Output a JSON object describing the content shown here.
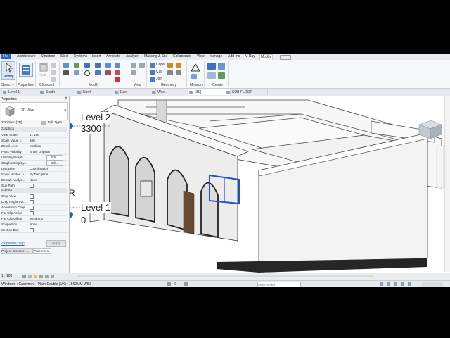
{
  "menu": {
    "tabs": [
      "File",
      "Architecture",
      "Structure",
      "Steel",
      "Systems",
      "Insert",
      "Annotate",
      "Analyze",
      "Massing & Site",
      "Collaborate",
      "View",
      "Manage",
      "Add-Ins",
      "V-Ray",
      "Modify"
    ]
  },
  "ribbon": {
    "select_label": "Select ▾",
    "groups": [
      "Properties",
      "Clipboard",
      "Modify",
      "View",
      "Geometry",
      "Measure",
      "Create"
    ],
    "modify_btn": "Modify",
    "paste_btn": "Paste",
    "cope_label": "Cope",
    "cut_label": "Cut",
    "join_label": "Join"
  },
  "view_tabs": [
    "Level 1",
    "South",
    "North",
    "East",
    "West",
    "{3D}",
    "SUB-FLOOR"
  ],
  "properties": {
    "title": "Properties",
    "type_name": "3D View",
    "selector": "3D View: {3D}",
    "edit_type": "Edit Type",
    "sections": {
      "graphics": "Graphics",
      "extents": "Extents"
    },
    "graphics_rows": [
      {
        "k": "View Scale",
        "v": "1 : 100"
      },
      {
        "k": "Scale Value  1:",
        "v": "100"
      },
      {
        "k": "Detail Level",
        "v": "Medium"
      },
      {
        "k": "Parts Visibility",
        "v": "Show Original"
      },
      {
        "k": "Visibility/Graph...",
        "v": "Edit..."
      },
      {
        "k": "Graphic Display...",
        "v": "Edit..."
      },
      {
        "k": "Discipline",
        "v": "Coordination"
      },
      {
        "k": "Show Hidden Li...",
        "v": "By Discipline"
      },
      {
        "k": "Default Analys...",
        "v": "None"
      },
      {
        "k": "Sun Path",
        "v": ""
      }
    ],
    "extents_rows": [
      {
        "k": "Crop View",
        "v": ""
      },
      {
        "k": "Crop Region Vi...",
        "v": ""
      },
      {
        "k": "Annotation Crop",
        "v": ""
      },
      {
        "k": "Far Clip Active",
        "v": ""
      },
      {
        "k": "Far Clip Offset",
        "v": "304800.0"
      },
      {
        "k": "Scope Box",
        "v": "None"
      },
      {
        "k": "Section Box",
        "v": ""
      }
    ],
    "help": "Properties help",
    "apply": "Apply",
    "bottom_tabs": [
      "Project Browser -...",
      "Properties"
    ]
  },
  "viewport": {
    "level2": "Level 2",
    "level2_elev": "3300",
    "level1": "Level 1",
    "level1_elev": "0",
    "r_label": "R"
  },
  "view_control": {
    "scale": "1 : 100"
  },
  "status": {
    "message": "Windows : Casement - Plain-Double (UK) : 1500MM WIN",
    "model": "Main Model",
    "zero": ":0"
  },
  "colors": {
    "accent": "#2867c5",
    "selection": "#2250c8",
    "wall": "#f4f4f4",
    "wall_shade": "#cfcfcf",
    "base": "#2a2a2a",
    "door": "#6b4a32"
  }
}
